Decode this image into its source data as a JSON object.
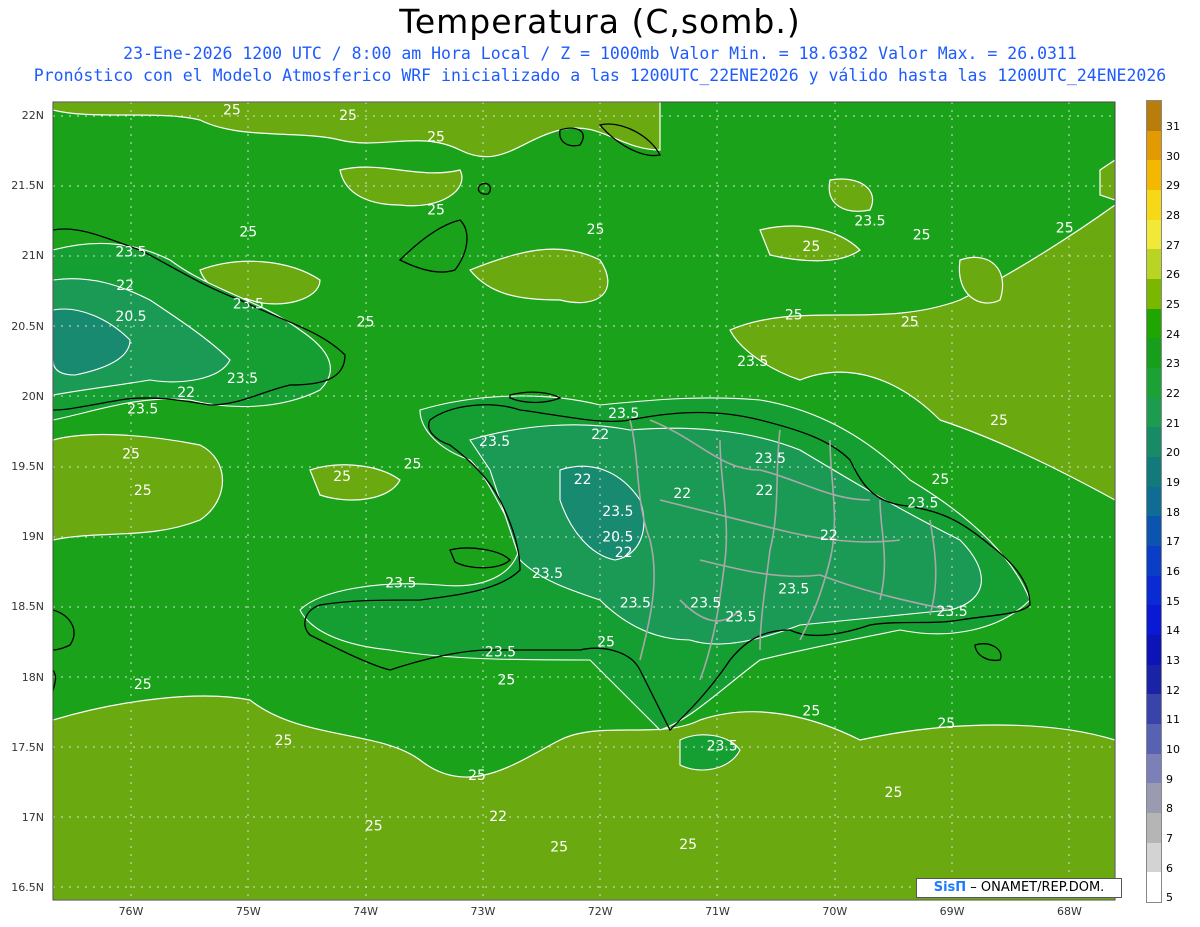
{
  "title": "Temperatura (C,somb.)",
  "subtitle_line1": "23-Ene-2026  1200 UTC / 8:00 am Hora Local / Z = 1000mb   Valor Min. = 18.6382  Valor Max. = 26.0311",
  "subtitle_line2": "Pronóstico con el Modelo Atmosferico WRF inicializado a las 1200UTC_22ENE2026 y válido hasta las  1200UTC_24ENE2026",
  "credit": {
    "brand": "SisΠ",
    "text": " – ONAMET/REP.DOM."
  },
  "y_ticks": [
    "22N",
    "21.5N",
    "21N",
    "20.5N",
    "20N",
    "19.5N",
    "19N",
    "18.5N",
    "18N",
    "17.5N",
    "17N",
    "16.5N"
  ],
  "x_ticks": [
    "76W",
    "75W",
    "74W",
    "73W",
    "72W",
    "71W",
    "70W",
    "69W",
    "68W"
  ],
  "contour_levels": [
    "20.5",
    "22",
    "23.5",
    "25"
  ],
  "colorbar": {
    "labels": [
      "31",
      "30",
      "29",
      "28",
      "27",
      "26",
      "25",
      "24",
      "23",
      "22",
      "21",
      "20",
      "19",
      "18",
      "17",
      "16",
      "15",
      "14",
      "13",
      "12",
      "11",
      "10",
      "9",
      "8",
      "7",
      "6",
      "5"
    ],
    "colors": [
      "#b87d0a",
      "#e39a00",
      "#f5b800",
      "#f7d817",
      "#f2e838",
      "#b9d422",
      "#7cb700",
      "#20a600",
      "#159f1a",
      "#1aa334",
      "#1c9c4e",
      "#178a66",
      "#137a7c",
      "#0f6c95",
      "#0b55b0",
      "#0a3ec6",
      "#0a2ad4",
      "#0a1ad4",
      "#0c14b8",
      "#1a22a6",
      "#3844aa",
      "#5862b2",
      "#7c80b8",
      "#9a9ab0",
      "#b5b5b5",
      "#d3d3d3",
      "#ffffff"
    ]
  },
  "colors": {
    "sea_25": "#1aa31a",
    "land_high": "#6aaa10",
    "warm_band": "#7db51a",
    "cool_23": "#159f33",
    "cool_22": "#1a9a55",
    "cool_20": "#178a70",
    "coast": "#000000",
    "border": "#a8a8a8",
    "contour": "#ffffff"
  },
  "contour_labels": [
    {
      "text": "25",
      "lon": -75.14,
      "lat": 22.01
    },
    {
      "text": "25",
      "lon": -74.15,
      "lat": 21.97
    },
    {
      "text": "25",
      "lon": -73.4,
      "lat": 21.82
    },
    {
      "text": "25",
      "lon": -75.0,
      "lat": 21.14
    },
    {
      "text": "23.5",
      "lon": -76.0,
      "lat": 21.0
    },
    {
      "text": "22",
      "lon": -76.05,
      "lat": 20.76
    },
    {
      "text": "23.5",
      "lon": -75.0,
      "lat": 20.63
    },
    {
      "text": "20.5",
      "lon": -76.0,
      "lat": 20.54
    },
    {
      "text": "25",
      "lon": -74.0,
      "lat": 20.5
    },
    {
      "text": "23.5",
      "lon": -75.05,
      "lat": 20.1
    },
    {
      "text": "22",
      "lon": -75.53,
      "lat": 20.0
    },
    {
      "text": "23.5",
      "lon": -75.9,
      "lat": 19.88
    },
    {
      "text": "25",
      "lon": -73.4,
      "lat": 21.3
    },
    {
      "text": "25",
      "lon": -72.04,
      "lat": 21.16
    },
    {
      "text": "25",
      "lon": -70.2,
      "lat": 21.04
    },
    {
      "text": "25",
      "lon": -70.35,
      "lat": 20.55
    },
    {
      "text": "23.5",
      "lon": -70.7,
      "lat": 20.22
    },
    {
      "text": "25",
      "lon": -69.36,
      "lat": 20.5
    },
    {
      "text": "23.5",
      "lon": -69.7,
      "lat": 21.22
    },
    {
      "text": "25",
      "lon": -69.26,
      "lat": 21.12
    },
    {
      "text": "25",
      "lon": -68.04,
      "lat": 21.17
    },
    {
      "text": "25",
      "lon": -68.6,
      "lat": 19.8
    },
    {
      "text": "25",
      "lon": -76.0,
      "lat": 19.56
    },
    {
      "text": "25",
      "lon": -74.2,
      "lat": 19.4
    },
    {
      "text": "25",
      "lon": -75.9,
      "lat": 19.3
    },
    {
      "text": "25",
      "lon": -73.6,
      "lat": 19.49
    },
    {
      "text": "23.5",
      "lon": -72.9,
      "lat": 19.65
    },
    {
      "text": "22",
      "lon": -72.0,
      "lat": 19.7
    },
    {
      "text": "23.5",
      "lon": -71.8,
      "lat": 19.85
    },
    {
      "text": "22",
      "lon": -72.15,
      "lat": 19.38
    },
    {
      "text": "20.5",
      "lon": -71.85,
      "lat": 18.97
    },
    {
      "text": "23.5",
      "lon": -71.85,
      "lat": 19.15
    },
    {
      "text": "22",
      "lon": -71.3,
      "lat": 19.28
    },
    {
      "text": "23.5",
      "lon": -70.55,
      "lat": 19.53
    },
    {
      "text": "22",
      "lon": -70.6,
      "lat": 19.3
    },
    {
      "text": "22",
      "lon": -70.05,
      "lat": 18.98
    },
    {
      "text": "23.5",
      "lon": -69.25,
      "lat": 19.21
    },
    {
      "text": "25",
      "lon": -69.1,
      "lat": 19.38
    },
    {
      "text": "23.5",
      "lon": -72.45,
      "lat": 18.71
    },
    {
      "text": "22",
      "lon": -71.8,
      "lat": 18.86
    },
    {
      "text": "23.5",
      "lon": -71.7,
      "lat": 18.5
    },
    {
      "text": "23.5",
      "lon": -71.1,
      "lat": 18.5
    },
    {
      "text": "23.5",
      "lon": -70.8,
      "lat": 18.4
    },
    {
      "text": "23.5",
      "lon": -70.35,
      "lat": 18.6
    },
    {
      "text": "23.5",
      "lon": -69.0,
      "lat": 18.44
    },
    {
      "text": "23.5",
      "lon": -73.7,
      "lat": 18.64
    },
    {
      "text": "23.5",
      "lon": -72.85,
      "lat": 18.15
    },
    {
      "text": "25",
      "lon": -71.95,
      "lat": 18.22
    },
    {
      "text": "25",
      "lon": -72.8,
      "lat": 17.95
    },
    {
      "text": "25",
      "lon": -75.9,
      "lat": 17.92
    },
    {
      "text": "25",
      "lon": -74.7,
      "lat": 17.52
    },
    {
      "text": "23.5",
      "lon": -70.96,
      "lat": 17.48
    },
    {
      "text": "25",
      "lon": -70.2,
      "lat": 17.73
    },
    {
      "text": "25",
      "lon": -69.05,
      "lat": 17.64
    },
    {
      "text": "25",
      "lon": -73.05,
      "lat": 17.27
    },
    {
      "text": "25",
      "lon": -73.93,
      "lat": 16.91
    },
    {
      "text": "22",
      "lon": -72.87,
      "lat": 16.98
    },
    {
      "text": "25",
      "lon": -72.35,
      "lat": 16.76
    },
    {
      "text": "25",
      "lon": -71.25,
      "lat": 16.78
    },
    {
      "text": "25",
      "lon": -69.5,
      "lat": 17.15
    },
    {
      "text": "25",
      "lon": -71.3,
      "lat": 16.37
    }
  ]
}
